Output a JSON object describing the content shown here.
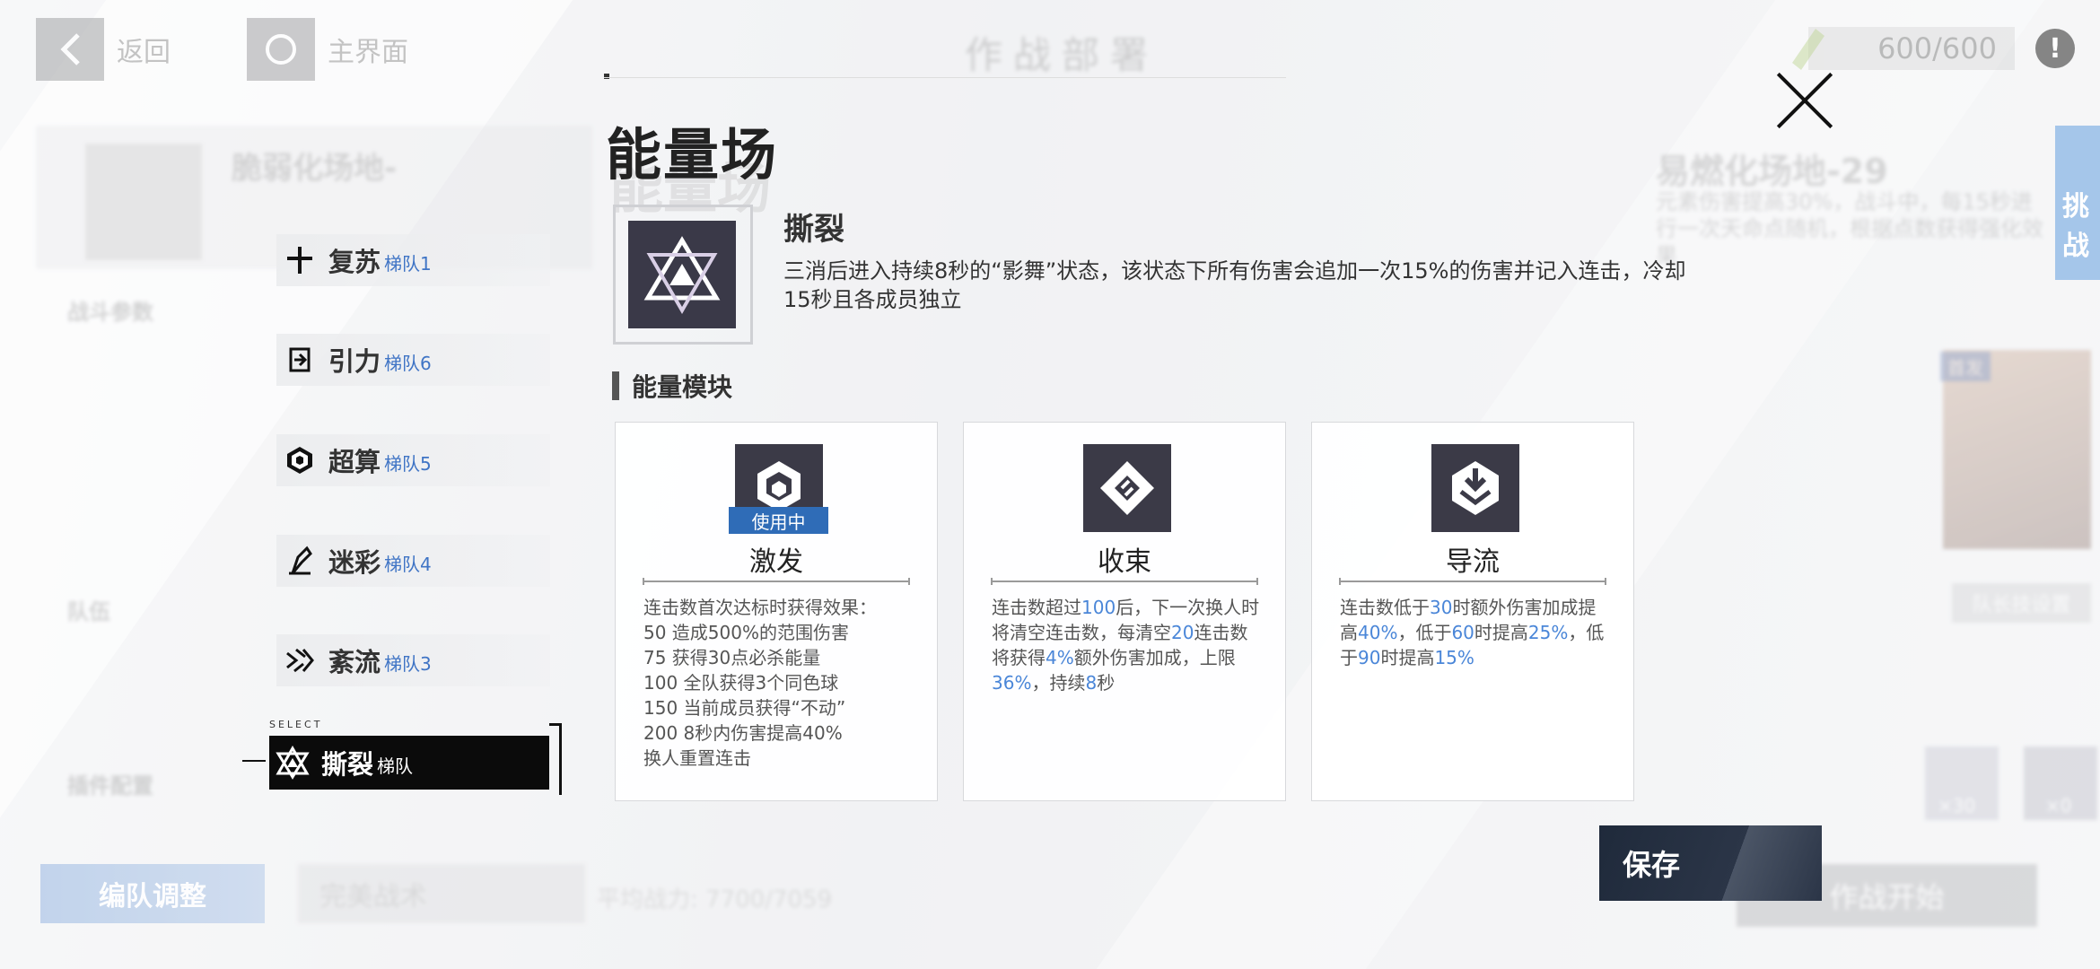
{
  "background": {
    "back_label": "返回",
    "home_label": "主界面",
    "header_title": "作战部署",
    "energy": "600/600",
    "info_icon": "!",
    "stage_title": "易燃化场地-29",
    "stage_desc": "元素伤害提高30%，战斗中，每15秒进行一次天命点随机，根据点数获得强化效果",
    "challenge_label": "挑战",
    "left_panel_title": "脆弱化场地-",
    "battle_params": "战斗参数",
    "team_label": "队伍",
    "plugin_label": "插件配置",
    "first_label": "首发",
    "leader_skill": "队长技设置",
    "count_a": "×30",
    "count_b": "×0",
    "edit_team": "编队调整",
    "perfect_tactic": "完美战术",
    "avg_power": "平均战力: 7700/7059",
    "start_label": "作战开始"
  },
  "panel": {
    "title": "能量场",
    "skill_name": "撕裂",
    "skill_desc": "三消后进入持续8秒的“影舞”状态，该状态下所有伤害会追加一次15%的伤害并记入连击，冷却15秒且各成员独立",
    "section_title": "能量模块",
    "save_label": "保存",
    "select_tag": "SELECT"
  },
  "fields": [
    {
      "name": "复苏",
      "tag": "梯队1",
      "icon": "plus-icon"
    },
    {
      "name": "引力",
      "tag": "梯队6",
      "icon": "gravity-icon"
    },
    {
      "name": "超算",
      "tag": "梯队5",
      "icon": "cube-icon"
    },
    {
      "name": "迷彩",
      "tag": "梯队4",
      "icon": "camo-icon"
    },
    {
      "name": "紊流",
      "tag": "梯队3",
      "icon": "turbulence-icon"
    },
    {
      "name": "撕裂",
      "tag": "梯队",
      "icon": "rift-icon"
    }
  ],
  "modules": [
    {
      "name": "激发",
      "badge": "使用中",
      "icon": "burst-icon",
      "lines": [
        "连击数首次达标时获得效果：",
        "50  造成500%的范围伤害",
        "75   获得30点必杀能量",
        "100   全队获得3个同色球",
        "150 当前成员获得“不动”",
        "200 8秒内伤害提高40%",
        "换人重置连击"
      ]
    },
    {
      "name": "收束",
      "icon": "converge-icon",
      "text_parts": [
        "连击数超过",
        "100",
        "后，下一次换人时将清空连击数，每清空",
        "20",
        "连击数将获得",
        "4%",
        "额外伤害加成，上限",
        "36%",
        "，持续",
        "8",
        "秒"
      ]
    },
    {
      "name": "导流",
      "icon": "diversion-icon",
      "text_parts": [
        "连击数低于",
        "30",
        "时额外伤害加成提高",
        "40%",
        "，低于",
        "60",
        "时提高",
        "25%",
        "，低于",
        "90",
        "时提高",
        "15%"
      ]
    }
  ],
  "colors": {
    "accent": "#2f6cb7",
    "highlight": "#4a86d8",
    "dark": "#0b0b0b"
  }
}
